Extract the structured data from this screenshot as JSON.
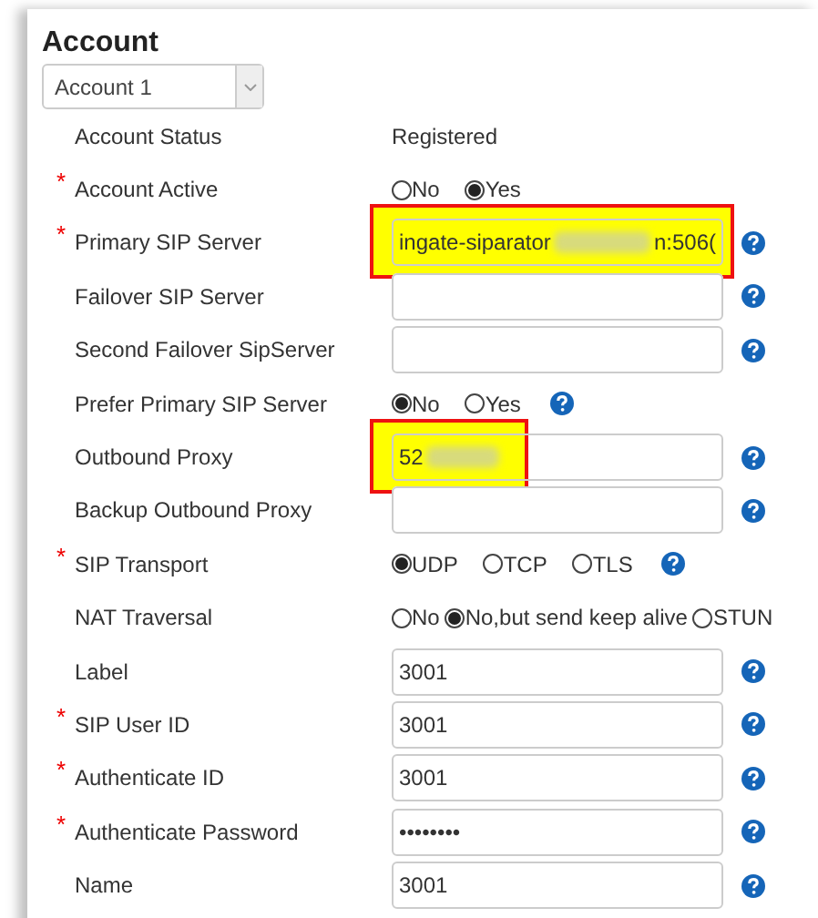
{
  "title": "Account",
  "account_select": {
    "value": "Account 1"
  },
  "rows": [
    {
      "kind": "text",
      "label": "Account Status",
      "value": "Registered",
      "help": false
    },
    {
      "kind": "radio",
      "label": "Account Active",
      "required_mark": "*",
      "help": false,
      "options": [
        {
          "label": "No",
          "selected": false
        },
        {
          "label": "Yes",
          "selected": true
        }
      ]
    },
    {
      "kind": "input",
      "label": "Primary SIP Server",
      "required_mark": "*",
      "help": true,
      "value": "ingate-siparator",
      "redacted": true,
      "value_end": "n:506(",
      "highlighted": true
    },
    {
      "kind": "input",
      "label": "Failover SIP Server",
      "help": true
    },
    {
      "kind": "input",
      "label": "Second Failover SipServer",
      "help": true
    },
    {
      "kind": "radio",
      "label": "Prefer Primary SIP Server",
      "help": true,
      "options": [
        {
          "label": "No",
          "selected": true
        },
        {
          "label": "Yes",
          "selected": false
        }
      ]
    },
    {
      "kind": "input",
      "label": "Outbound Proxy",
      "help": true,
      "value": "52",
      "redacted": true,
      "highlighted": true
    },
    {
      "kind": "input",
      "label": "Backup Outbound Proxy",
      "help": true
    },
    {
      "kind": "radio",
      "label": "SIP Transport",
      "required_mark": "*",
      "help": true,
      "options": [
        {
          "label": "UDP",
          "selected": true
        },
        {
          "label": "TCP",
          "selected": false
        },
        {
          "label": "TLS",
          "selected": false
        }
      ]
    },
    {
      "kind": "radio",
      "label": "NAT Traversal",
      "help": false,
      "options": [
        {
          "label": "No",
          "selected": false
        },
        {
          "label": "No,but send keep alive",
          "selected": true
        },
        {
          "label": "STUN",
          "selected": false
        }
      ]
    },
    {
      "kind": "input",
      "label": "Label",
      "help": true,
      "value": "3001"
    },
    {
      "kind": "input",
      "label": "SIP User ID",
      "required_mark": "*",
      "help": true,
      "value": "3001"
    },
    {
      "kind": "input",
      "label": "Authenticate ID",
      "required_mark": "*",
      "help": true,
      "value": "3001"
    },
    {
      "kind": "input",
      "label": "Authenticate Password",
      "required_mark": "*",
      "help": true,
      "value": "••••••••"
    },
    {
      "kind": "input",
      "label": "Name",
      "help": true,
      "value": "3001"
    }
  ]
}
